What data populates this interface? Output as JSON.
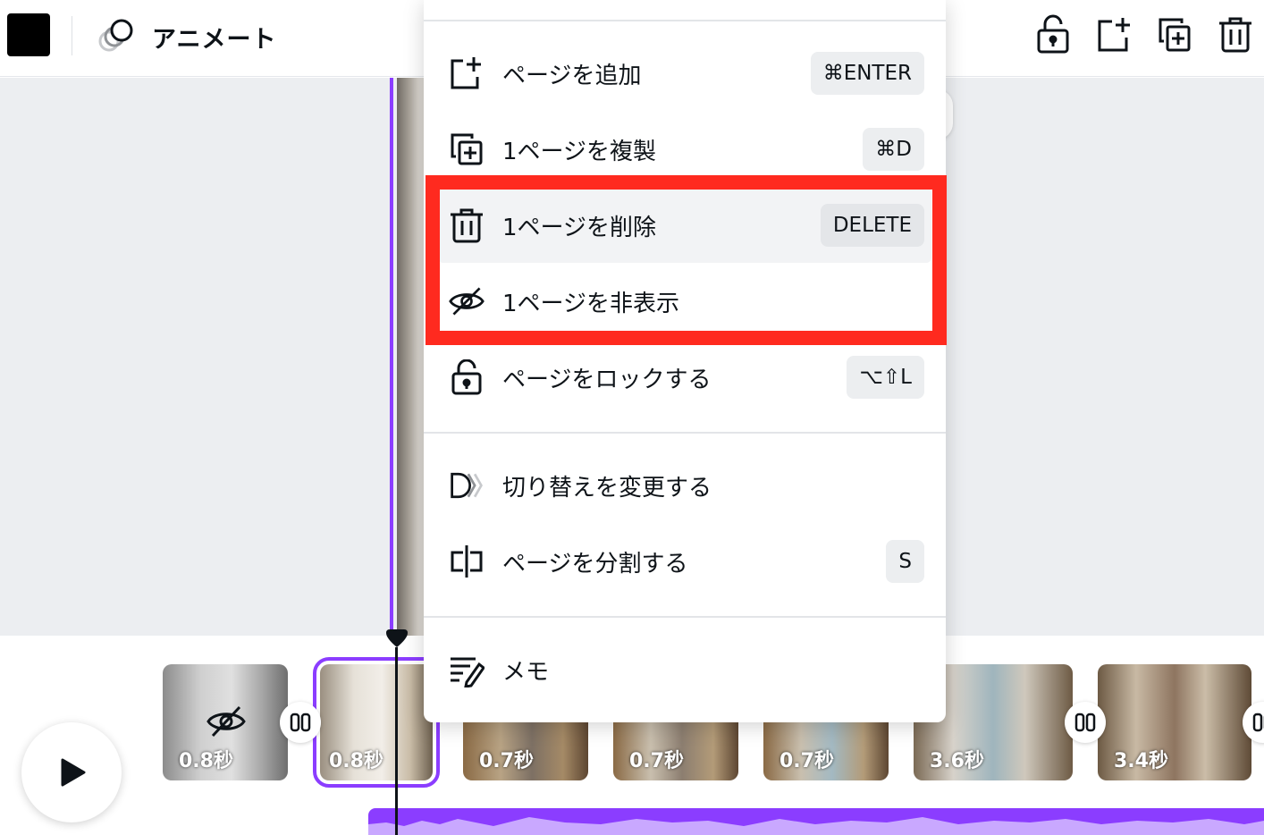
{
  "topbar": {
    "animate_label": "アニメート",
    "color_swatch": "#000000",
    "icons": [
      "lock-open-icon",
      "add-page-icon",
      "duplicate-page-icon",
      "trash-icon"
    ]
  },
  "menu": {
    "items": [
      {
        "icon": "add-page-icon",
        "label": "ページを追加",
        "shortcut": "⌘ENTER"
      },
      {
        "icon": "duplicate-page-icon",
        "label": "1ページを複製",
        "shortcut": "⌘D"
      },
      {
        "icon": "trash-icon",
        "label": "1ページを削除",
        "shortcut": "DELETE"
      },
      {
        "icon": "eye-off-icon",
        "label": "1ページを非表示",
        "shortcut": ""
      },
      {
        "icon": "lock-open-icon",
        "label": "ページをロックする",
        "shortcut": "⌥⇧L"
      },
      {
        "icon": "transition-icon",
        "label": "切り替えを変更する",
        "shortcut": ""
      },
      {
        "icon": "split-icon",
        "label": "ページを分割する",
        "shortcut": "S"
      },
      {
        "icon": "notes-icon",
        "label": "メモ",
        "shortcut": ""
      }
    ]
  },
  "timeline": {
    "thumbnails": [
      {
        "duration": "0.8秒",
        "hidden": true
      },
      {
        "duration": "0.8秒",
        "selected": true
      },
      {
        "duration": "0.7秒"
      },
      {
        "duration": "0.7秒"
      },
      {
        "duration": "0.7秒"
      },
      {
        "duration": "3.6秒"
      },
      {
        "duration": "3.4秒"
      }
    ]
  },
  "colors": {
    "accent": "#8b3dff",
    "highlight": "#ff2a1f"
  }
}
